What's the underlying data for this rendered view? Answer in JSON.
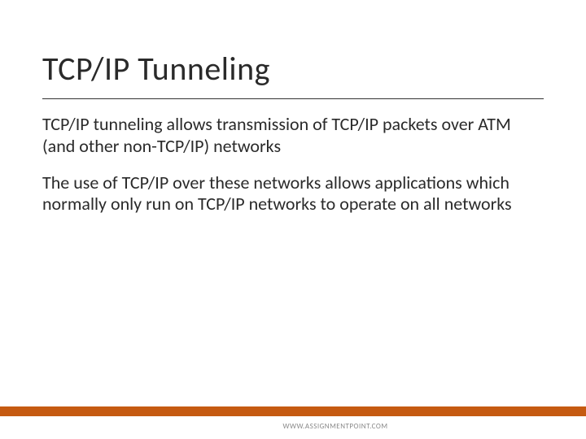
{
  "slide": {
    "title": "TCP/IP Tunneling",
    "paragraphs": [
      "TCP/IP tunneling allows transmission of TCP/IP packets over ATM (and other non-TCP/IP) networks",
      "The use of TCP/IP over these networks allows applications which normally only run on TCP/IP networks to operate on all networks"
    ],
    "footer": "WWW.ASSIGNMENTPOINT.COM"
  },
  "colors": {
    "accent": "#c55a11"
  }
}
